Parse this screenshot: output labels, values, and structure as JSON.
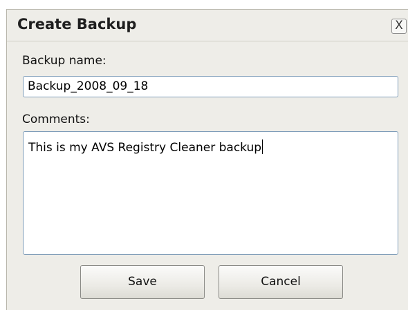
{
  "dialog": {
    "title": "Create Backup",
    "close_glyph": "X",
    "close_icon": "close-icon"
  },
  "form": {
    "name_label": "Backup name:",
    "name_value": "Backup_2008_09_18",
    "comments_label": "Comments:",
    "comments_value": "This is my AVS Registry Cleaner backup"
  },
  "buttons": {
    "save_label": "Save",
    "cancel_label": "Cancel"
  }
}
